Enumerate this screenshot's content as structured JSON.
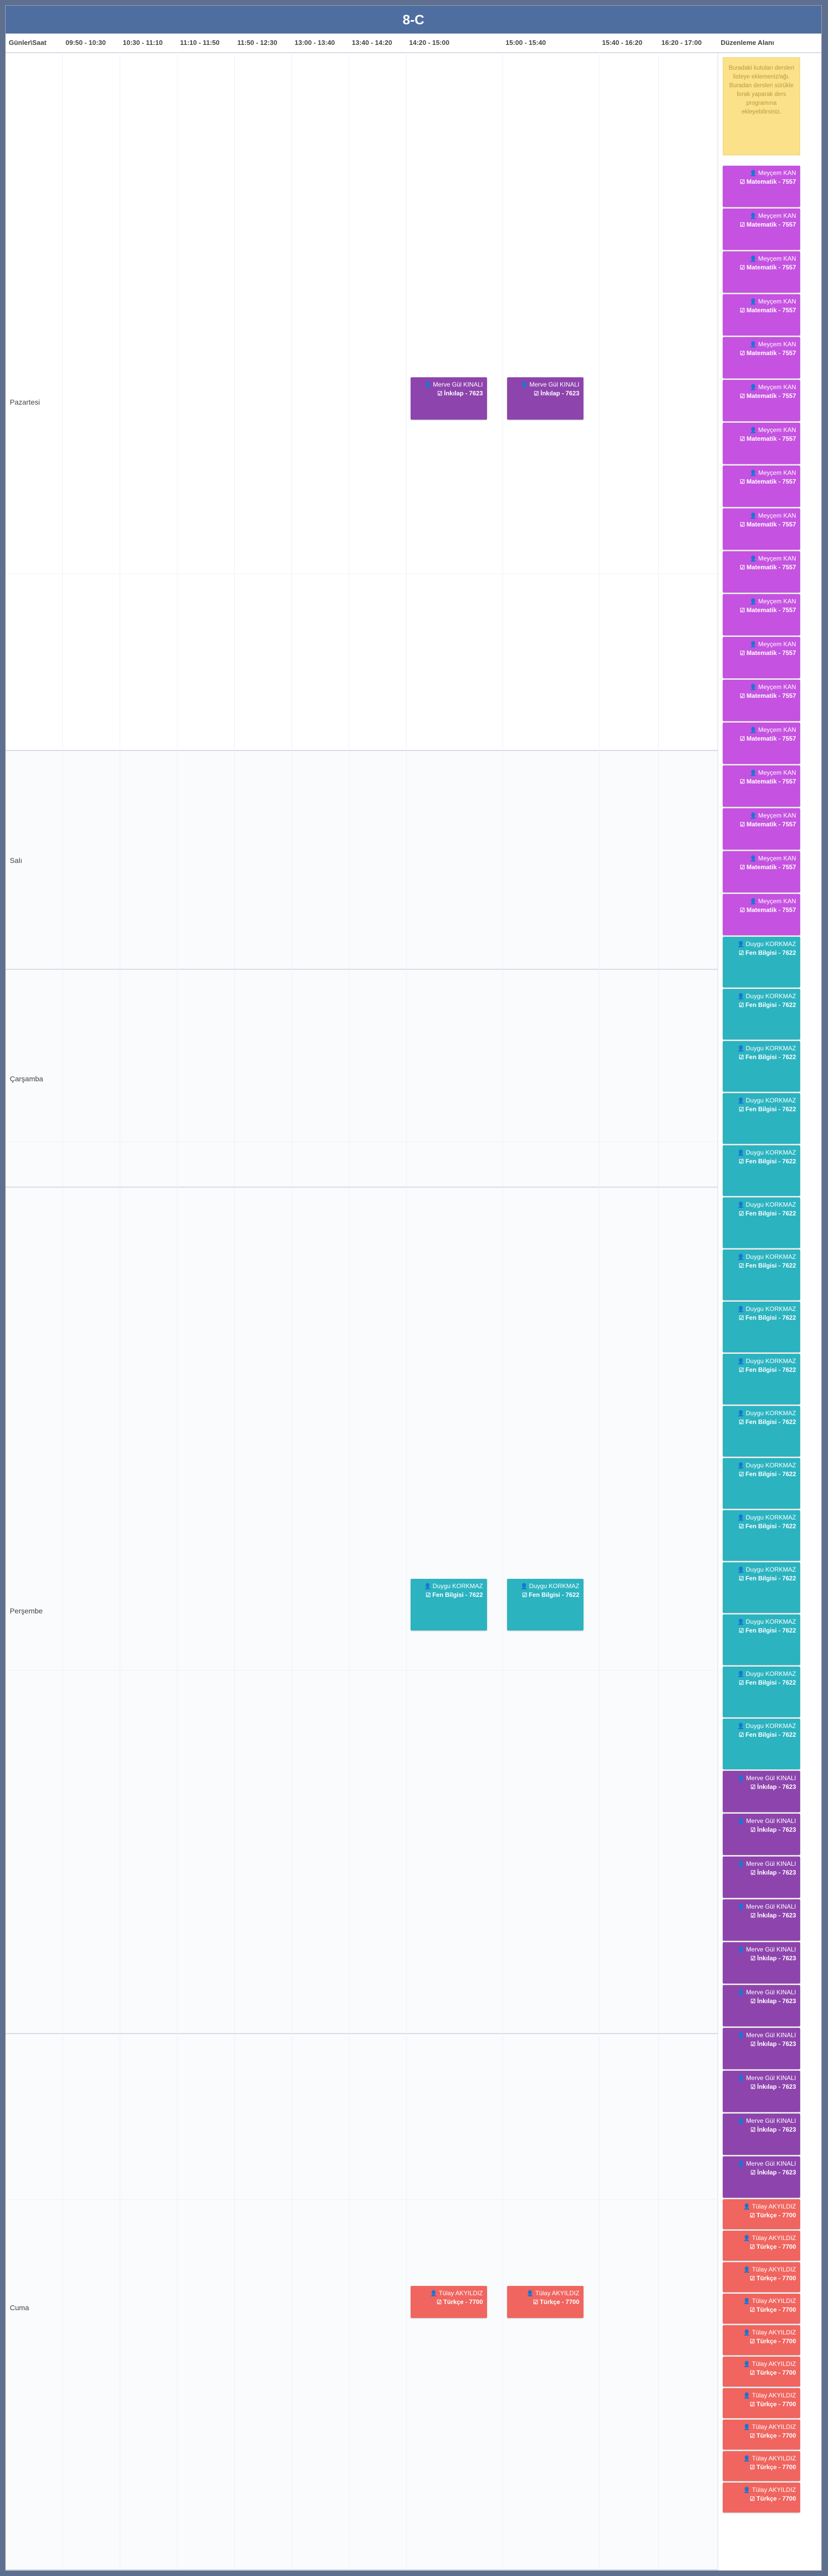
{
  "title": "8-C",
  "header": {
    "col0": "Günler\\Saat",
    "times": [
      "09:50 - 10:30",
      "10:30 - 11:10",
      "11:10 - 11:50",
      "11:50 - 12:30",
      "13:00 - 13:40",
      "13:40 - 14:20",
      "14:20 - 15:00",
      "15:00 - 15:40",
      "15:40 - 16:20",
      "16:20 - 17:00"
    ],
    "edit_area": "Düzenleme Alanı"
  },
  "days": [
    "Pazartesi",
    "Salı",
    "Çarşamba",
    "Perşembe",
    "Cuma"
  ],
  "icons": {
    "teacher": "user-icon",
    "subject": "checkbox-icon"
  },
  "schedule": {
    "mon": [
      {
        "teacher": "Merve Gül KINALI",
        "subject": "İnkılap - 7623"
      },
      {
        "teacher": "Merve Gül KINALI",
        "subject": "İnkılap - 7623"
      }
    ],
    "thu": [
      {
        "teacher": "Duygu KORKMAZ",
        "subject": "Fen Bilgisi - 7622"
      },
      {
        "teacher": "Duygu KORKMAZ",
        "subject": "Fen Bilgisi - 7622"
      }
    ],
    "fri": [
      {
        "teacher": "Tülay AKYILDIZ",
        "subject": "Türkçe - 7700"
      },
      {
        "teacher": "Tülay AKYILDIZ",
        "subject": "Türkçe - 7700"
      }
    ]
  },
  "note": "Buradaki kutuları dersleri listeye eklemeniz/ağı. Buradan dersleri sürükle bırak yaparak ders programına ekleyebilirsiniz.",
  "side_groups": [
    {
      "teacher": "Meyçem KAN",
      "subject": "Matematik - 7557",
      "count": 18,
      "color": "magenta"
    },
    {
      "teacher": "Duygu KORKMAZ",
      "subject": "Fen Bilgisi - 7622",
      "count": 16,
      "color": "teal"
    },
    {
      "teacher": "Merve Gül KINALI",
      "subject": "İnkılap - 7623",
      "count": 10,
      "color": "purple"
    },
    {
      "teacher": "Tülay AKYILDIZ",
      "subject": "Türkçe - 7700",
      "count": 10,
      "color": "coral"
    }
  ],
  "colors": {
    "purple": "#8e44ad",
    "magenta": "#c552e0",
    "teal": "#2bb3c0",
    "coral": "#f0655f",
    "titlebar": "#4f6ea0",
    "note": "#fbe18a"
  }
}
